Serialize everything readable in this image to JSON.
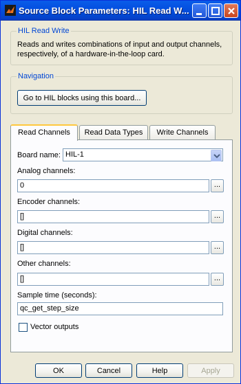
{
  "window": {
    "title": "Source Block Parameters: HIL Read W..."
  },
  "description_group": {
    "legend": "HIL Read Write",
    "text": "Reads and writes combinations of input and output channels, respectively,  of a hardware-in-the-loop card."
  },
  "navigation_group": {
    "legend": "Navigation",
    "button_label": "Go to HIL blocks using this board..."
  },
  "tabs": [
    {
      "label": "Read Channels",
      "active": true
    },
    {
      "label": "Read Data Types",
      "active": false
    },
    {
      "label": "Write Channels",
      "active": false
    }
  ],
  "form": {
    "board_label": "Board name:",
    "board_value": "HIL-1",
    "analog_label": "Analog channels:",
    "analog_value": "0",
    "encoder_label": "Encoder channels:",
    "encoder_value": "[]",
    "digital_label": "Digital channels:",
    "digital_value": "[]",
    "other_label": "Other channels:",
    "other_value": "[]",
    "sample_time_label": "Sample time (seconds):",
    "sample_time_value": "qc_get_step_size",
    "vector_outputs_label": "Vector outputs",
    "vector_outputs_checked": false,
    "browse_label": "..."
  },
  "buttons": {
    "ok": "OK",
    "cancel": "Cancel",
    "help": "Help",
    "apply": "Apply"
  },
  "colors": {
    "accent": "#0046d5",
    "titlebar": "#0450e0",
    "background": "#ece9d8"
  }
}
